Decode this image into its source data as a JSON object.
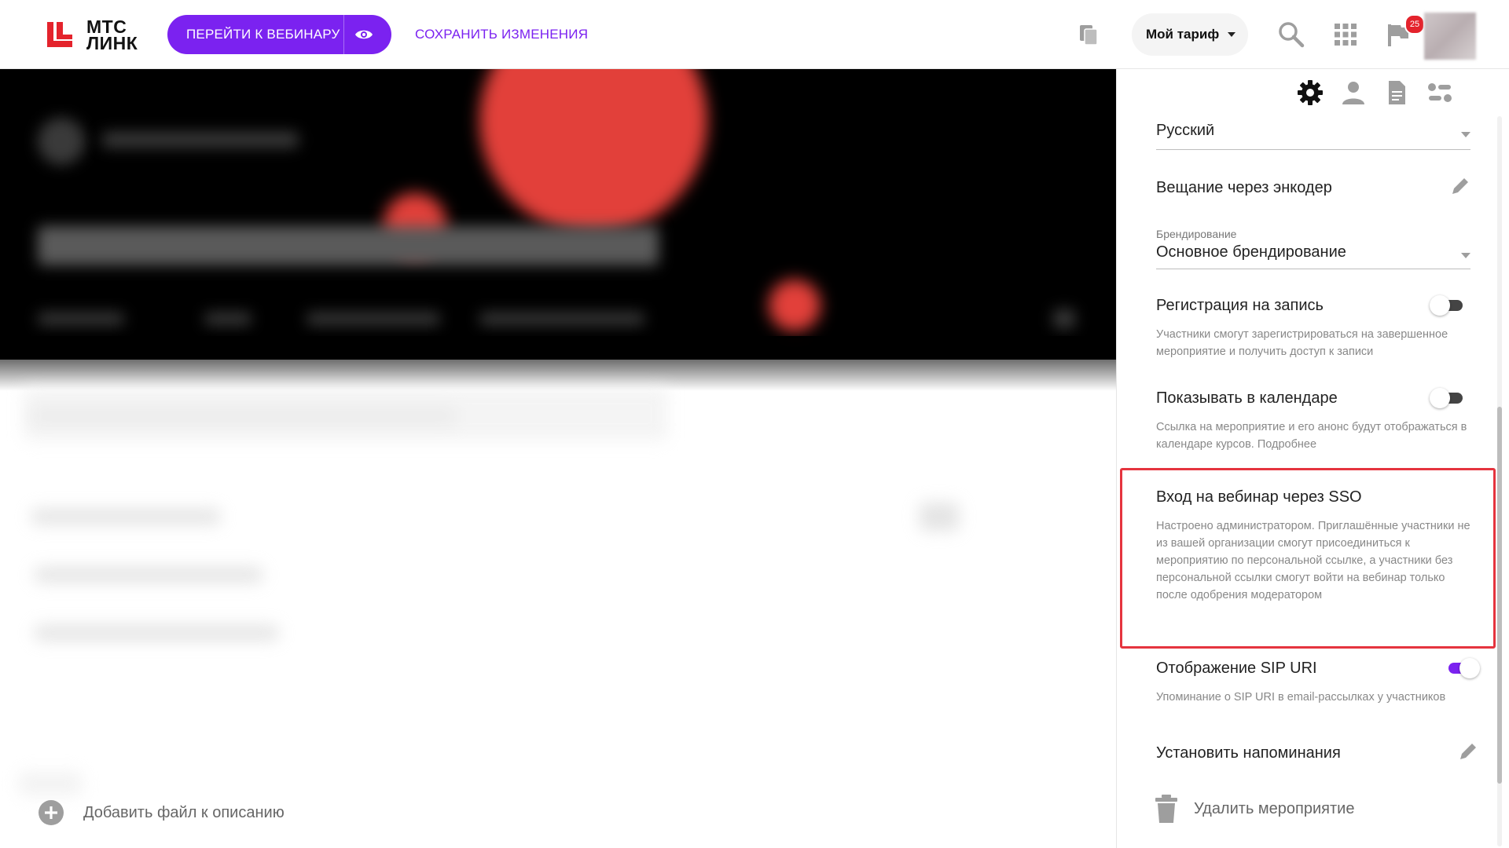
{
  "header": {
    "logo_line1": "МТС",
    "logo_line2": "ЛИНК",
    "go_to_webinar_label": "ПЕРЕЙТИ К ВЕБИНАРУ",
    "save_changes_label": "СОХРАНИТЬ ИЗМЕНЕНИЯ",
    "tariff_label": "Мой тариф",
    "notifications_count": "25",
    "brand_color": "#7b22f0",
    "icons": [
      "copy-icon",
      "search-icon",
      "apps-grid-icon",
      "flag-icon",
      "eye-icon"
    ]
  },
  "main": {
    "add_file_label": "Добавить файл к описанию"
  },
  "settings_panel": {
    "tabs": [
      "gear-icon",
      "person-icon",
      "document-icon",
      "list-settings-icon"
    ],
    "language_value": "Русский",
    "encoder_label": "Вещание через энкодер",
    "branding_label": "Брендирование",
    "branding_value": "Основное брендирование",
    "recording_registration": {
      "title": "Регистрация на запись",
      "description": "Участники смогут зарегистрироваться на завершенное мероприятие и получить доступ к записи",
      "enabled": false
    },
    "show_in_calendar": {
      "title": "Показывать в календаре",
      "description": "Ссылка на мероприятие и его анонс будут отображаться в календаре курсов. Подробнее",
      "enabled": false
    },
    "sso_login": {
      "title": "Вход на вебинар через SSO",
      "description": "Настроено администратором. Приглашённые участники не из вашей организации смогут присоединиться к мероприятию по персональной ссылке, а участники без персональной ссылки смогут войти на вебинар только после одобрения модератором",
      "highlight_color": "#e5343e"
    },
    "sip_uri": {
      "title": "Отображение SIP URI",
      "description": "Упоминание о SIP URI в email-рассылках у участников",
      "enabled": true
    },
    "reminders_label": "Установить напоминания",
    "delete_label": "Удалить мероприятие"
  }
}
